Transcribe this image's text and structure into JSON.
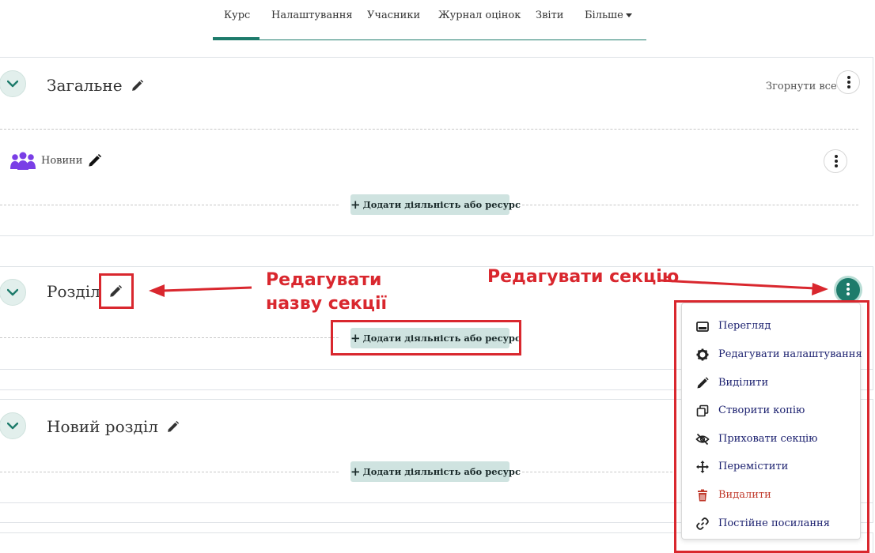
{
  "nav": {
    "tabs": [
      {
        "label": "Курс"
      },
      {
        "label": "Налаштування"
      },
      {
        "label": "Учасники"
      },
      {
        "label": "Журнал оцінок"
      },
      {
        "label": "Звіти"
      },
      {
        "label": "Більше"
      }
    ],
    "active_tab": "Курс"
  },
  "general_section": {
    "title": "Загальне",
    "collapse_all": "Згорнути все",
    "news_activity": "Новини",
    "add_button": "Додати діяльність або ресурс"
  },
  "section1": {
    "title": "Розділ",
    "add_button": "Додати діяльність або ресурс"
  },
  "section2": {
    "title": "Новий розділ",
    "add_button": "Додати діяльність або ресурс"
  },
  "section_menu": {
    "items": [
      {
        "label": "Перегляд",
        "icon": "preview-icon"
      },
      {
        "label": "Редагувати налаштування",
        "icon": "gear-icon"
      },
      {
        "label": "Виділити",
        "icon": "pencil-icon"
      },
      {
        "label": "Створити копію",
        "icon": "copy-icon"
      },
      {
        "label": "Приховати секцію",
        "icon": "eye-slash-icon"
      },
      {
        "label": "Перемістити",
        "icon": "move-icon"
      },
      {
        "label": "Видалити",
        "icon": "trash-icon"
      },
      {
        "label": "Постійне посилання",
        "icon": "link-icon"
      }
    ]
  },
  "annotations": {
    "edit_section_name_line1": "Редагувати",
    "edit_section_name_line2": "назву секції",
    "edit_section": "Редагувати секцію"
  },
  "colors": {
    "accent": "#1d7b6b",
    "annotation_red": "#d9272e",
    "menu_text": "#1a1f6e",
    "danger": "#c0392b",
    "add_button_bg": "#cfe3e0"
  }
}
